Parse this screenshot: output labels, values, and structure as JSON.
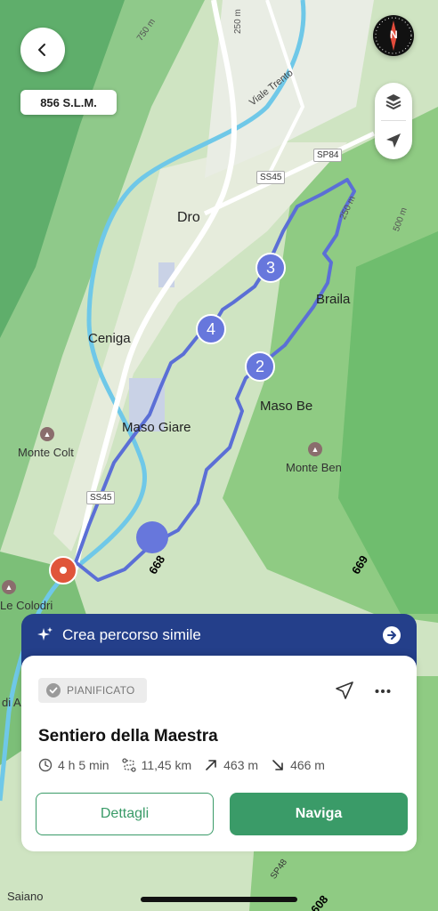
{
  "map": {
    "places": [
      {
        "name": "Dro"
      },
      {
        "name": "Ceniga"
      },
      {
        "name": "Braila"
      },
      {
        "name": "Maso Be"
      },
      {
        "name": "Maso Giare"
      },
      {
        "name": "Monte Colt"
      },
      {
        "name": "Monte Ben"
      },
      {
        "name": "Le Colodri"
      },
      {
        "name": "di A"
      },
      {
        "name": "Saiano"
      }
    ],
    "road_labels": [
      "SS45",
      "SP84",
      "SS45",
      "Viale Trento",
      "SP48"
    ],
    "contour_labels": [
      "750 m",
      "250 m",
      "500 m",
      "250 m"
    ],
    "trail_numbers": [
      "668",
      "669",
      "608"
    ],
    "waypoints": [
      "3",
      "4",
      "2"
    ],
    "colors": {
      "route": "#5b6fd6",
      "waypoint": "#6777dc",
      "start_pin": "#e0553a"
    }
  },
  "top": {
    "elevation": "856 S.L.M.",
    "compass_letter": "N"
  },
  "banner": {
    "label": "Crea percorso simile"
  },
  "route": {
    "status": "PIANIFICATO",
    "title": "Sentiero della Maestra",
    "duration": "4 h 5 min",
    "distance": "11,45 km",
    "ascent": "463 m",
    "descent": "466 m"
  },
  "actions": {
    "details": "Dettagli",
    "navigate": "Naviga"
  }
}
